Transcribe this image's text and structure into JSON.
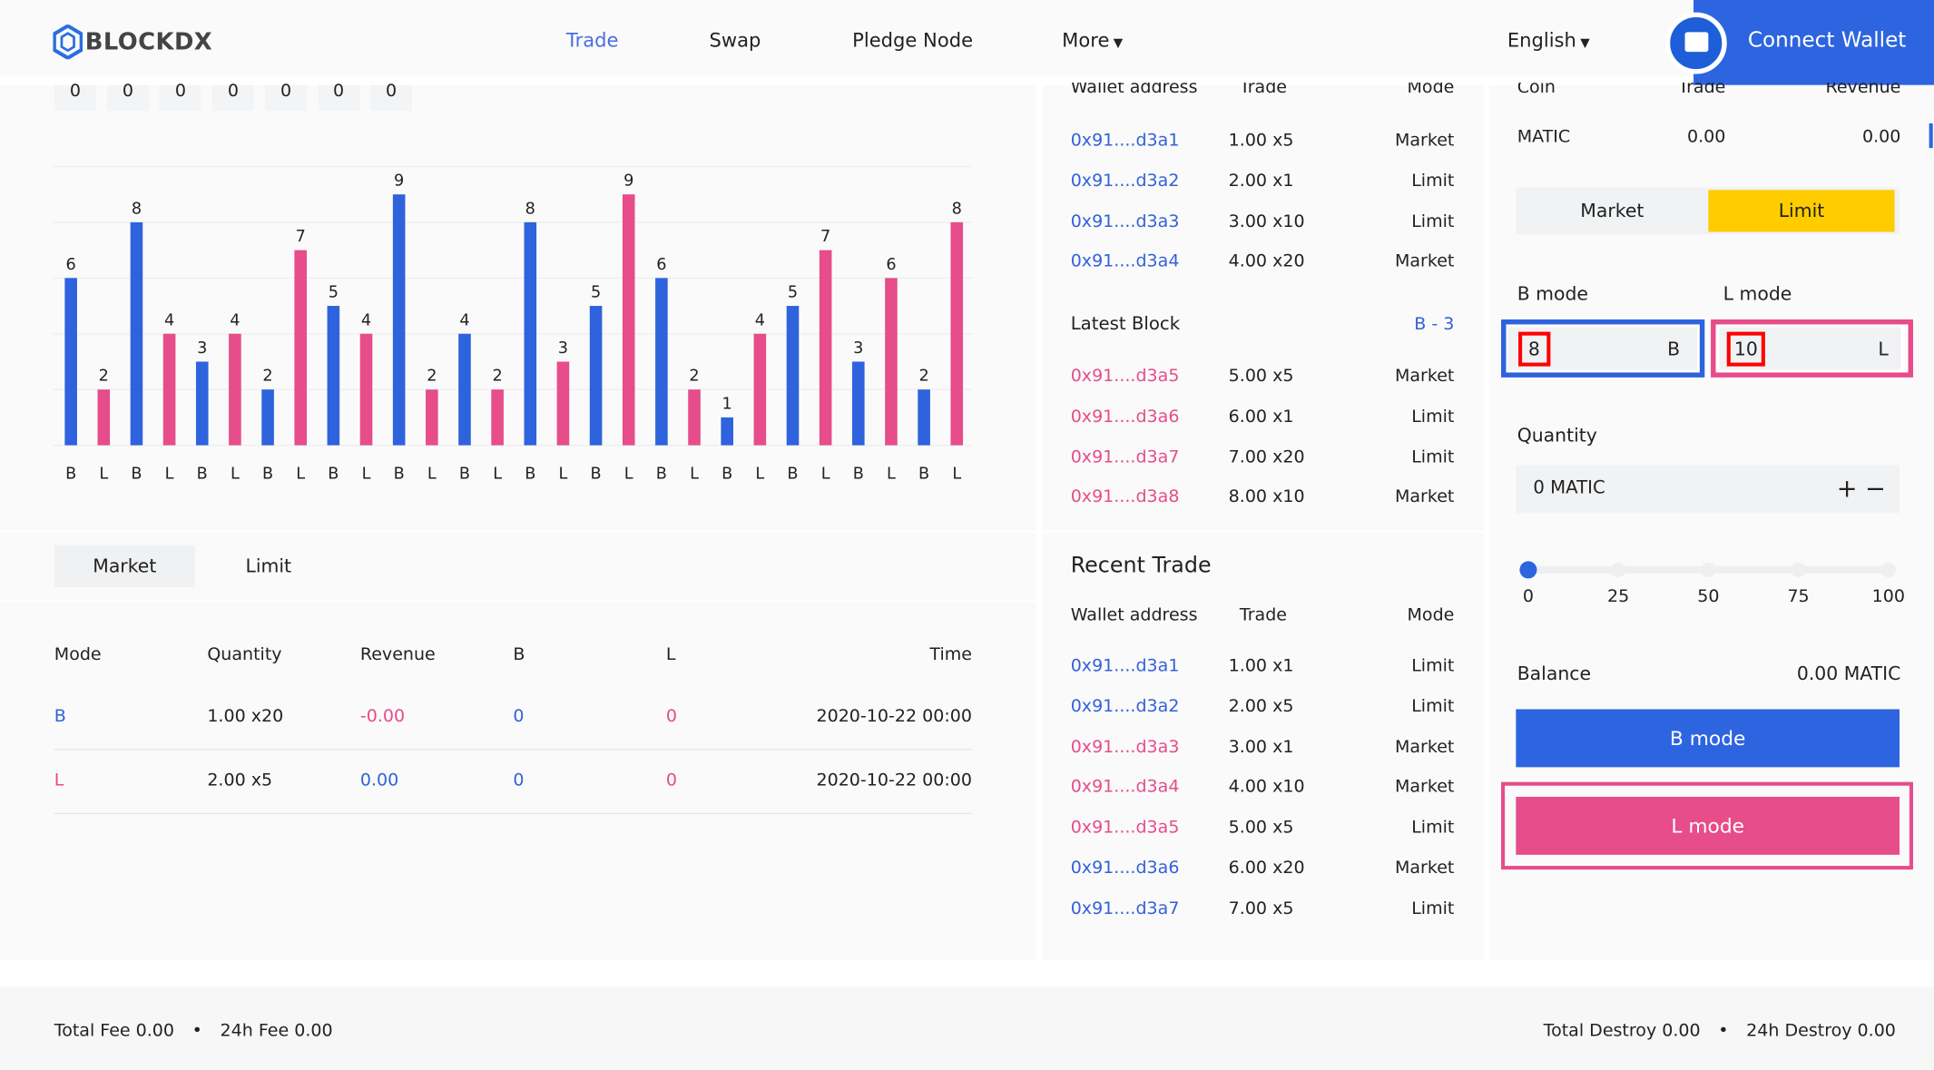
{
  "header": {
    "logo": "BLOCKDX",
    "nav": [
      {
        "label": "Trade",
        "active": true
      },
      {
        "label": "Swap"
      },
      {
        "label": "Pledge Node"
      },
      {
        "label": "More"
      }
    ],
    "language": "English",
    "connect_wallet": "Connect Wallet"
  },
  "colors": {
    "b": "#2e63dd",
    "l": "#e64d8a",
    "accent_yellow": "#ffcc00"
  },
  "zero_counters": [
    "0",
    "0",
    "0",
    "0",
    "0",
    "0",
    "0"
  ],
  "chart_data": {
    "type": "bar",
    "categories": [
      "B",
      "L",
      "B",
      "L",
      "B",
      "L",
      "B",
      "L",
      "B",
      "L",
      "B",
      "L",
      "B",
      "L",
      "B",
      "L",
      "B",
      "L",
      "B",
      "L",
      "B",
      "L",
      "B",
      "L",
      "B",
      "L",
      "B",
      "L"
    ],
    "values": [
      6,
      2,
      8,
      4,
      3,
      4,
      2,
      7,
      5,
      4,
      9,
      2,
      4,
      2,
      8,
      3,
      5,
      9,
      6,
      2,
      1,
      4,
      5,
      7,
      3,
      6,
      2,
      8
    ],
    "ylim": [
      0,
      10
    ],
    "grid": true,
    "data_labels": true
  },
  "order_tabs": {
    "market": "Market",
    "limit": "Limit"
  },
  "orders_table": {
    "headers": [
      "Mode",
      "Quantity",
      "Revenue",
      "B",
      "L",
      "Time"
    ],
    "rows": [
      [
        "B",
        "1.00 x20",
        "-0.00",
        "0",
        "0",
        "2020-10-22 00:00"
      ],
      [
        "L",
        "2.00 x5",
        "0.00",
        "0",
        "0",
        "2020-10-22 00:00"
      ]
    ]
  },
  "book": {
    "headers": [
      "Wallet address",
      "Trade",
      "Mode"
    ],
    "rows": [
      [
        "0x91....d3a1",
        "1.00 x5",
        "Market"
      ],
      [
        "0x91....d3a2",
        "2.00 x1",
        "Limit"
      ],
      [
        "0x91....d3a3",
        "3.00 x10",
        "Limit"
      ],
      [
        "0x91....d3a4",
        "4.00 x20",
        "Market"
      ]
    ],
    "latest_block_label": "Latest Block",
    "latest_block_value": "B - 3",
    "block_rows": [
      [
        "0x91....d3a5",
        "5.00 x5",
        "Market"
      ],
      [
        "0x91....d3a6",
        "6.00 x1",
        "Limit"
      ],
      [
        "0x91....d3a7",
        "7.00 x20",
        "Limit"
      ],
      [
        "0x91....d3a8",
        "8.00 x10",
        "Market"
      ]
    ]
  },
  "recent": {
    "title": "Recent Trade",
    "headers": [
      "Wallet address",
      "Trade",
      "Mode"
    ],
    "rows": [
      [
        "0x91....d3a1",
        "1.00 x1",
        "Limit",
        "b"
      ],
      [
        "0x91....d3a2",
        "2.00 x5",
        "Limit",
        "b"
      ],
      [
        "0x91....d3a3",
        "3.00 x1",
        "Market",
        "l"
      ],
      [
        "0x91....d3a4",
        "4.00 x10",
        "Market",
        "l"
      ],
      [
        "0x91....d3a5",
        "5.00 x5",
        "Limit",
        "l"
      ],
      [
        "0x91....d3a6",
        "6.00 x20",
        "Market",
        "b"
      ],
      [
        "0x91....d3a7",
        "7.00 x5",
        "Limit",
        "b"
      ]
    ]
  },
  "trade": {
    "coin_headers": [
      "Coin",
      "Trade",
      "Revenue"
    ],
    "coin_row": [
      "MATIC",
      "0.00",
      "0.00"
    ],
    "market": "Market",
    "limit": "Limit",
    "b_mode_label": "B mode",
    "l_mode_label": "L mode",
    "b_value": "8",
    "b_suffix": "B",
    "l_value": "10",
    "l_suffix": "L",
    "quantity_label": "Quantity",
    "quantity_value": "0 MATIC",
    "plus": "+",
    "minus": "−",
    "slider_value": 0,
    "slider_marks": [
      "0",
      "25",
      "50",
      "75",
      "100"
    ],
    "balance_label": "Balance",
    "balance_value": "0.00 MATIC",
    "b_button": "B mode",
    "l_button": "L mode"
  },
  "footer": {
    "total_fee": "Total Fee 0.00",
    "fee_24h": "24h Fee 0.00",
    "total_destroy": "Total Destroy 0.00",
    "destroy_24h": "24h Destroy 0.00",
    "sep": "•"
  }
}
